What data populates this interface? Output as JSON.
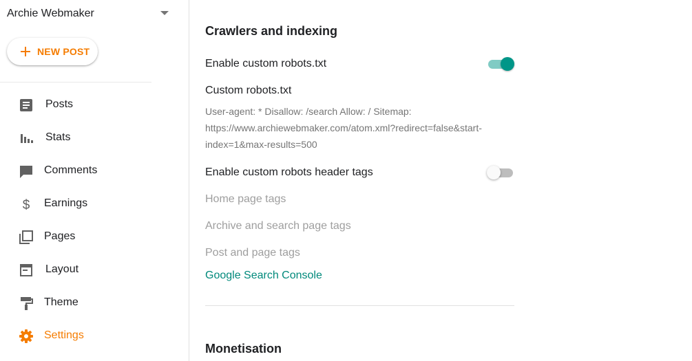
{
  "sidebar": {
    "blog_name": "Archie Webmaker",
    "new_post_label": "NEW POST",
    "items": [
      {
        "label": "Posts",
        "icon": "posts-icon"
      },
      {
        "label": "Stats",
        "icon": "stats-icon"
      },
      {
        "label": "Comments",
        "icon": "comments-icon"
      },
      {
        "label": "Earnings",
        "icon": "dollar-icon"
      },
      {
        "label": "Pages",
        "icon": "pages-icon"
      },
      {
        "label": "Layout",
        "icon": "layout-icon"
      },
      {
        "label": "Theme",
        "icon": "paint-roller-icon"
      },
      {
        "label": "Settings",
        "icon": "gear-icon",
        "active": true
      }
    ]
  },
  "main": {
    "crawlers": {
      "title": "Crawlers and indexing",
      "enable_robots_label": "Enable custom robots.txt",
      "enable_robots_on": true,
      "custom_robots_label": "Custom robots.txt",
      "custom_robots_value": "User-agent: * Disallow: /search Allow: / Sitemap: https://www.archiewebmaker.com/atom.xml?redirect=false&start-index=1&max-results=500",
      "enable_header_tags_label": "Enable custom robots header tags",
      "enable_header_tags_on": false,
      "home_tags_label": "Home page tags",
      "archive_tags_label": "Archive and search page tags",
      "post_tags_label": "Post and page tags",
      "search_console_link": "Google Search Console"
    },
    "monetisation": {
      "title": "Monetisation"
    }
  },
  "colors": {
    "accent_orange": "#f57c00",
    "teal": "#009688",
    "link_teal": "#00897b",
    "disabled_text": "#9e9e9e"
  }
}
